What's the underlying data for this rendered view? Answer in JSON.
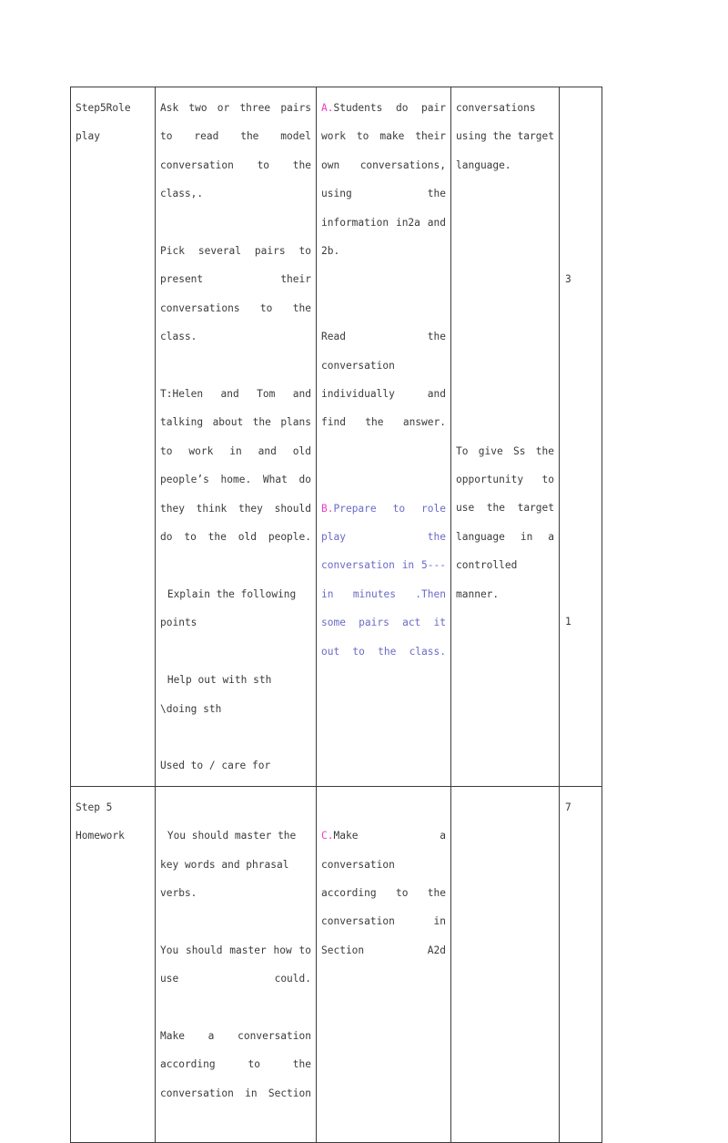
{
  "document": {
    "type": "lesson-plan-table",
    "page_background": "#ffffff",
    "border_color": "#3c3c3c",
    "text_color": "#3a3a3a",
    "accent_pink": "#e83fc8",
    "accent_blue": "#6a6ac8"
  },
  "table": {
    "columns": 5,
    "rows": 2,
    "row1": {
      "col1": {
        "line1": "Step5Role",
        "line2": "play"
      },
      "col2": {
        "para1": "Ask two or three pairs to read the model conversation to the class,.",
        "para2": "Pick several pairs to present their conversations to the class.",
        "para3": "T:Helen and Tom and talking about the plans to work in and old people’s home. What do they think they should do to the old people.",
        "para4": "Explain the following points",
        "para5": "Help out with sth \\doing sth",
        "para6": "Used to / care for"
      },
      "col3": {
        "blockA_marker": "A.",
        "blockA_text": "Students do pair work to make their own conversations, using the information in2a and 2b.",
        "blockB_text": "Read the conversation individually and find the answer.",
        "blockC_marker": "B.",
        "blockC_text": "Prepare to role play the conversation in 5--- in minutes .Then some pairs act it out to the class."
      },
      "col4": {
        "para1": "conversations using the target language.",
        "para2": "To give Ss the opportunity to use the target language in a controlled manner."
      },
      "col5": {
        "num1": "3",
        "num2": "1"
      }
    },
    "row2": {
      "col1": {
        "line1": "Step 5",
        "line2": "Homework"
      },
      "col2": {
        "para1": "You should master the key words and phrasal verbs.",
        "para2": "You should master how to use could.",
        "para3": "Make a conversation according to the conversation in Section"
      },
      "col3": {
        "blockC_marker": "C.",
        "blockC_text": "Make a conversation according to the conversation in Section A2d"
      },
      "col4": {
        "para1": ""
      },
      "col5": {
        "num1": "7"
      }
    }
  }
}
